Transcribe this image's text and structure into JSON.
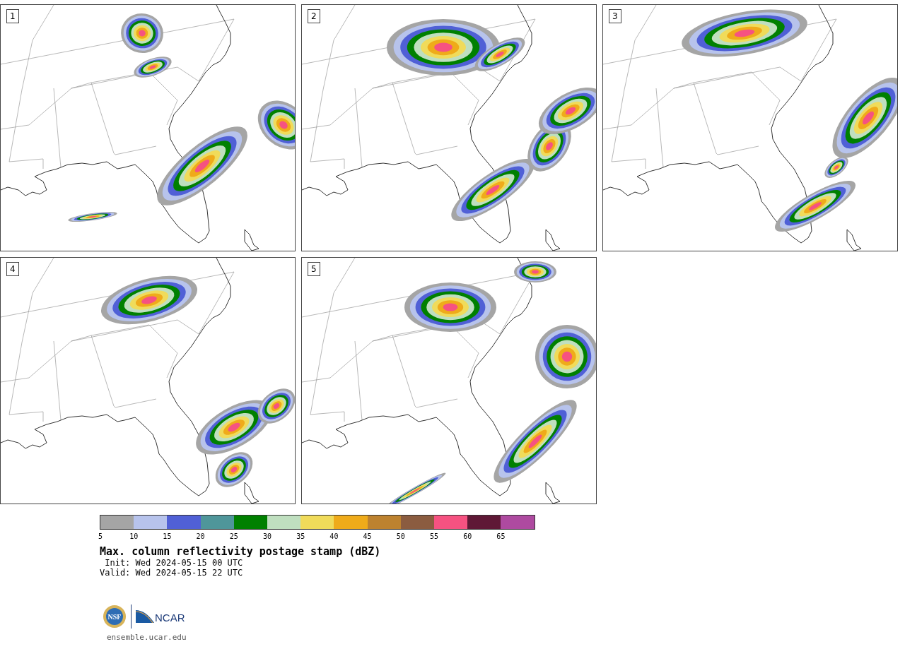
{
  "panels": [
    {
      "label": "1"
    },
    {
      "label": "2"
    },
    {
      "label": "3"
    },
    {
      "label": "4"
    },
    {
      "label": "5"
    }
  ],
  "colorbar": {
    "bins": [
      {
        "color": "#a5a5a5"
      },
      {
        "color": "#b7c3ec"
      },
      {
        "color": "#5060d6"
      },
      {
        "color": "#4f969a"
      },
      {
        "color": "#008000"
      },
      {
        "color": "#bfdfbf"
      },
      {
        "color": "#f0db5a"
      },
      {
        "color": "#efab1a"
      },
      {
        "color": "#bd822f"
      },
      {
        "color": "#8b5c40"
      },
      {
        "color": "#f65281"
      },
      {
        "color": "#5f1836"
      },
      {
        "color": "#ae4aa0"
      }
    ],
    "ticks": [
      "5",
      "10",
      "15",
      "20",
      "25",
      "30",
      "35",
      "40",
      "45",
      "50",
      "55",
      "60",
      "65"
    ]
  },
  "title": "Max. column reflectivity postage stamp (dBZ)",
  "init": " Init: Wed 2024-05-15 00 UTC",
  "valid": "Valid: Wed 2024-05-15 22 UTC",
  "logo": {
    "nsf_text": "NSF",
    "ncar_text": "NCAR"
  },
  "url": "ensemble.ucar.edu"
}
